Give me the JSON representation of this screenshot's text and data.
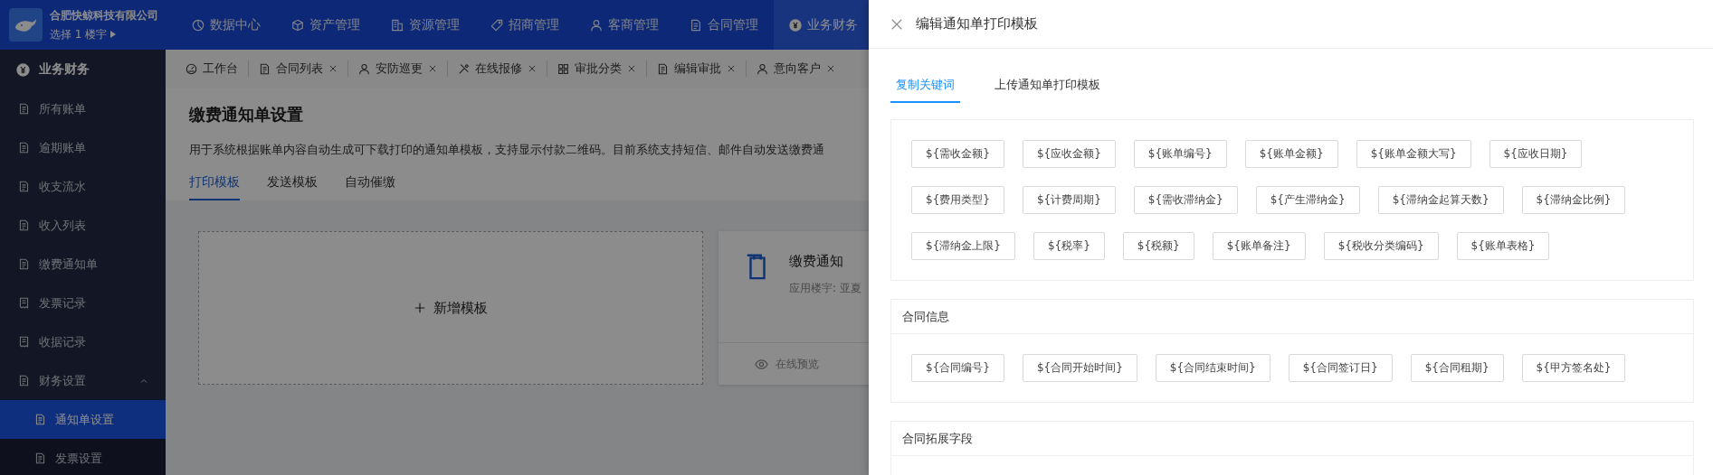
{
  "company": {
    "name": "合肥快鲸科技有限公司",
    "building": "选择 1 楼宇"
  },
  "top_nav": [
    {
      "label": "数据中心",
      "selected": false
    },
    {
      "label": "资产管理",
      "selected": false
    },
    {
      "label": "资源管理",
      "selected": false
    },
    {
      "label": "招商管理",
      "selected": false
    },
    {
      "label": "客商管理",
      "selected": false
    },
    {
      "label": "合同管理",
      "selected": false
    },
    {
      "label": "业务财务",
      "selected": true
    }
  ],
  "sidebar": {
    "section": "业务财务",
    "items": [
      {
        "label": "所有账单",
        "selected": false
      },
      {
        "label": "逾期账单",
        "selected": false
      },
      {
        "label": "收支流水",
        "selected": false
      },
      {
        "label": "收入列表",
        "selected": false
      },
      {
        "label": "缴费通知单",
        "selected": false
      },
      {
        "label": "发票记录",
        "selected": false
      },
      {
        "label": "收据记录",
        "selected": false
      },
      {
        "label": "财务设置",
        "selected": false,
        "expanded": true,
        "children": [
          {
            "label": "通知单设置",
            "selected": true
          },
          {
            "label": "发票设置",
            "selected": false
          }
        ]
      }
    ]
  },
  "open_tabs": [
    {
      "label": "工作台",
      "closable": false
    },
    {
      "label": "合同列表",
      "closable": true
    },
    {
      "label": "安防巡更",
      "closable": true
    },
    {
      "label": "在线报修",
      "closable": true
    },
    {
      "label": "审批分类",
      "closable": true
    },
    {
      "label": "编辑审批",
      "closable": true
    },
    {
      "label": "意向客户",
      "closable": true
    }
  ],
  "page": {
    "title": "缴费通知单设置",
    "description": "用于系统根据账单内容自动生成可下载打印的通知单模板，支持显示付款二维码。目前系统支持短信、邮件自动发送缴费通",
    "tabs": [
      {
        "label": "打印模板",
        "selected": true
      },
      {
        "label": "发送模板",
        "selected": false
      },
      {
        "label": "自动催缴",
        "selected": false
      }
    ],
    "new_template": "新增模板",
    "template_card": {
      "title": "缴费通知",
      "subtitle": "应用楼宇: 亚夏",
      "action": "在线预览"
    }
  },
  "drawer": {
    "title": "编辑通知单打印模板",
    "tabs": [
      {
        "label": "复制关键词",
        "selected": true
      },
      {
        "label": "上传通知单打印模板",
        "selected": false
      }
    ],
    "groups": [
      {
        "keywords": [
          "${需收金额}",
          "${应收金额}",
          "${账单编号}",
          "${账单金额}",
          "${账单金额大写}",
          "${应收日期}",
          "${费用类型}",
          "${计费周期}",
          "${需收滞纳金}",
          "${产生滞纳金}",
          "${滞纳金起算天数}",
          "${滞纳金比例}",
          "${滞纳金上限}",
          "${税率}",
          "${税额}",
          "${账单备注}",
          "${税收分类编码}",
          "${账单表格}"
        ]
      },
      {
        "title": "合同信息",
        "keywords": [
          "${合同编号}",
          "${合同开始时间}",
          "${合同结束时间}",
          "${合同签订日}",
          "${合同租期}",
          "${甲方签名处}"
        ]
      },
      {
        "title": "合同拓展字段"
      }
    ]
  }
}
